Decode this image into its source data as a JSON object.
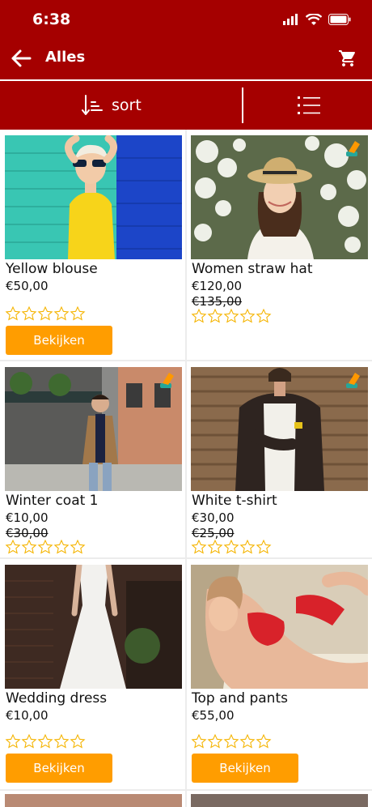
{
  "status": {
    "time": "6:38"
  },
  "header": {
    "title": "Alles"
  },
  "toolbar": {
    "sort_label": "sort"
  },
  "colors": {
    "primary": "#a50000",
    "accent": "#ff9d00",
    "star": "#f5b400"
  },
  "icons": {
    "back": "arrow-left-icon",
    "cart": "cart-icon",
    "sort": "sort-icon",
    "view": "list-view-icon",
    "tag": "discount-tag-icon"
  },
  "products": [
    {
      "name": "Yellow blouse",
      "price": "€50,00",
      "old_price": "",
      "button": "Bekijken",
      "rating": 0
    },
    {
      "name": "Women straw hat",
      "price": "€120,00",
      "old_price": "€135,00",
      "button": "",
      "rating": 0
    },
    {
      "name": "Winter coat 1",
      "price": "€10,00",
      "old_price": "€30,00",
      "button": "",
      "rating": 0
    },
    {
      "name": "White t-shirt",
      "price": "€30,00",
      "old_price": "€25,00",
      "button": "",
      "rating": 0
    },
    {
      "name": "Wedding dress",
      "price": "€10,00",
      "old_price": "",
      "button": "Bekijken",
      "rating": 0
    },
    {
      "name": "Top and pants",
      "price": "€55,00",
      "old_price": "",
      "button": "Bekijken",
      "rating": 0
    }
  ]
}
